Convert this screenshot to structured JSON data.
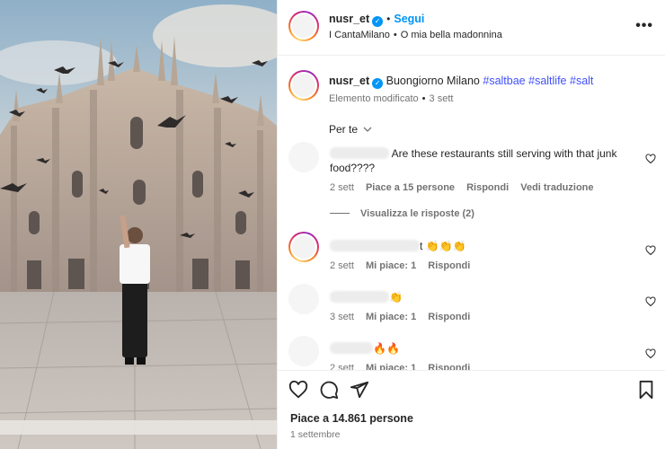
{
  "header": {
    "username": "nusr_et",
    "follow_label": "Segui",
    "audio": "I CantaMilano",
    "location": "O mia bella madonnina",
    "separator": "•",
    "more_label": "•••"
  },
  "caption": {
    "username": "nusr_et",
    "text": "Buongiorno Milano",
    "hashtags": [
      "#saltbae",
      "#saltlife",
      "#salt"
    ],
    "edited": "Elemento modificato",
    "age": "3 sett"
  },
  "sort_label": "Per te",
  "comments": [
    {
      "text": "Are these restaurants still serving with that junk food????",
      "age": "2 sett",
      "likes": "Piace a 15 persone",
      "reply": "Rispondi",
      "translate": "Vedi traduzione"
    },
    {
      "text": "t 👏👏👏",
      "age": "2 sett",
      "likes": "Mi piace: 1",
      "reply": "Rispondi"
    },
    {
      "text": "👏",
      "age": "3 sett",
      "likes": "Mi piace: 1",
      "reply": "Rispondi"
    },
    {
      "text": "🔥🔥",
      "age": "2 sett",
      "likes": "Mi piace: 1",
      "reply": "Rispondi"
    }
  ],
  "view_replies": "Visualizza le risposte (2)",
  "footer": {
    "likes": "Piace a 14.861 persone",
    "date": "1 settembre"
  },
  "colors": {
    "link_blue": "#0095f6",
    "hashtag": "#4150f7",
    "muted": "#737373"
  }
}
